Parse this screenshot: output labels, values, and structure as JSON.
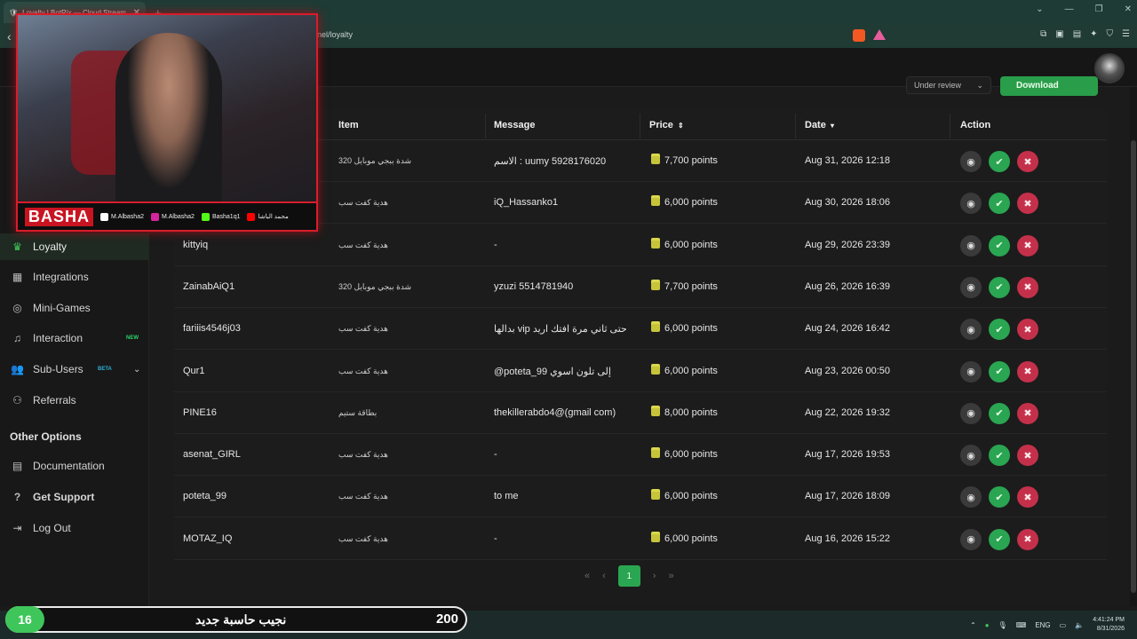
{
  "browser": {
    "tab_title": "Loyalty | BotRix — Cloud Stream",
    "tab_close": "✕",
    "new_tab": "+",
    "url": "anel/loyalty"
  },
  "toolbar": {
    "status_filter": "Under review",
    "download_label": "Download"
  },
  "sidebar": {
    "items": [
      {
        "label": "Loyalty",
        "icon": "trophy-icon"
      },
      {
        "label": "Integrations",
        "icon": "integrations-icon"
      },
      {
        "label": "Mini-Games",
        "icon": "gamepad-icon"
      },
      {
        "label": "Interaction",
        "icon": "music-icon",
        "badge": "NEW"
      },
      {
        "label": "Sub-Users",
        "icon": "users-icon",
        "badge": "BETA"
      },
      {
        "label": "Referrals",
        "icon": "referrals-icon"
      }
    ],
    "other_options_title": "Other Options",
    "other_items": [
      {
        "label": "Documentation",
        "icon": "book-icon"
      },
      {
        "label": "Get Support",
        "icon": "help-icon"
      },
      {
        "label": "Log Out",
        "icon": "logout-icon"
      }
    ]
  },
  "table": {
    "headers": {
      "item": "Item",
      "message": "Message",
      "price": "Price",
      "date": "Date",
      "action": "Action"
    },
    "rows": [
      {
        "user": "",
        "item": "شدة ببجي موبايل 320",
        "message": "الاسم : uumy 5928176020",
        "price": "7,700 points",
        "date": "Aug 31, 2026 12:18"
      },
      {
        "user": "",
        "item": "هدية كفت سب",
        "message": "iQ_Hassanko1",
        "price": "6,000 points",
        "date": "Aug 30, 2026 18:06"
      },
      {
        "user": "kittyiq",
        "item": "هدية كفت سب",
        "message": "-",
        "price": "6,000 points",
        "date": "Aug 29, 2026 23:39"
      },
      {
        "user": "ZainabAiQ1",
        "item": "شدة ببجي موبايل 320",
        "message": "yzuzi 5514781940",
        "price": "7,700 points",
        "date": "Aug 26, 2026 16:39"
      },
      {
        "user": "fariiis4546j03",
        "item": "هدية كفت سب",
        "message": "بدالها vip حتى ثاني مرة افتك اريد",
        "price": "6,000 points",
        "date": "Aug 24, 2026 16:42"
      },
      {
        "user": "Qur1",
        "item": "هدية كفت سب",
        "message": "@poteta_99 إلى تلون اسوي",
        "price": "6,000 points",
        "date": "Aug 23, 2026 00:50"
      },
      {
        "user": "PINE16",
        "item": "بطاقة ستيم",
        "message": "thekillerabdo4@(gmail com)",
        "price": "8,000 points",
        "date": "Aug 22, 2026 19:32"
      },
      {
        "user": "asenat_GIRL",
        "item": "هدية كفت سب",
        "message": "-",
        "price": "6,000 points",
        "date": "Aug 17, 2026 19:53"
      },
      {
        "user": "poteta_99",
        "item": "هدية كفت سب",
        "message": "to me",
        "price": "6,000 points",
        "date": "Aug 17, 2026 18:09"
      },
      {
        "user": "MOTAZ_IQ",
        "item": "هدية كفت سب",
        "message": "-",
        "price": "6,000 points",
        "date": "Aug 16, 2026 15:22"
      }
    ]
  },
  "pagination": {
    "first": "«",
    "prev": "‹",
    "current": "1",
    "next": "›",
    "last": "»"
  },
  "overlay": {
    "brand": "BASHA",
    "socials": [
      "M.Albasha2",
      "M.Albasha2",
      "Basha1q1",
      "محمد الباشا"
    ],
    "counter_badge": "16",
    "counter_text": "نجيب حاسبة جديد",
    "counter_value": "200"
  },
  "taskbar": {
    "lang": "ENG",
    "time": "4:41:24 PM",
    "date": "8/31/2026"
  },
  "colors": {
    "accent": "#2aa552",
    "danger": "#c4304a",
    "cam_border": "#d91d2a"
  }
}
